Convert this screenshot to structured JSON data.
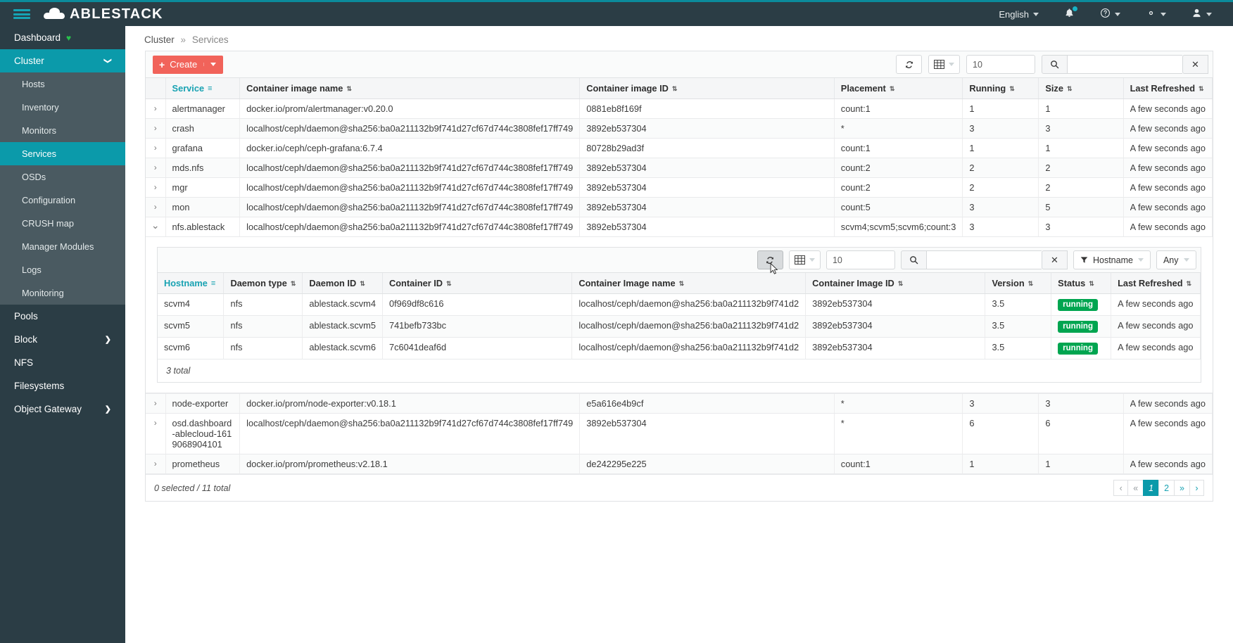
{
  "topbar": {
    "brand": "ABLESTACK",
    "language": "English",
    "icons": {
      "hamburger": "hamburger-icon",
      "bell": "notification-bell-icon",
      "help": "help-circle-icon",
      "settings": "gear-icon",
      "user": "user-icon"
    }
  },
  "sidebar": {
    "items": [
      {
        "label": "Dashboard",
        "level": "top",
        "state": "normal",
        "heart": true
      },
      {
        "label": "Cluster",
        "level": "top",
        "state": "expanded",
        "chevron": "chevron-down"
      },
      {
        "label": "Hosts",
        "level": "sub",
        "state": "normal"
      },
      {
        "label": "Inventory",
        "level": "sub",
        "state": "normal"
      },
      {
        "label": "Monitors",
        "level": "sub",
        "state": "normal"
      },
      {
        "label": "Services",
        "level": "sub",
        "state": "active"
      },
      {
        "label": "OSDs",
        "level": "sub",
        "state": "normal"
      },
      {
        "label": "Configuration",
        "level": "sub",
        "state": "normal"
      },
      {
        "label": "CRUSH map",
        "level": "sub",
        "state": "normal"
      },
      {
        "label": "Manager Modules",
        "level": "sub",
        "state": "normal"
      },
      {
        "label": "Logs",
        "level": "sub",
        "state": "normal"
      },
      {
        "label": "Monitoring",
        "level": "sub",
        "state": "normal"
      },
      {
        "label": "Pools",
        "level": "top",
        "state": "normal"
      },
      {
        "label": "Block",
        "level": "top",
        "state": "normal",
        "chevron": "chevron-right"
      },
      {
        "label": "NFS",
        "level": "top",
        "state": "normal"
      },
      {
        "label": "Filesystems",
        "level": "top",
        "state": "normal"
      },
      {
        "label": "Object Gateway",
        "level": "top",
        "state": "normal",
        "chevron": "chevron-right"
      }
    ]
  },
  "breadcrumb": {
    "parent": "Cluster",
    "separator": "»",
    "current": "Services"
  },
  "toolbar": {
    "create_label": "Create",
    "page_size": "10",
    "search_value": "",
    "search_placeholder": ""
  },
  "table": {
    "columns": [
      {
        "label": "Service",
        "sorted": true
      },
      {
        "label": "Container image name",
        "sorted": false
      },
      {
        "label": "Container image ID",
        "sorted": false
      },
      {
        "label": "Placement",
        "sorted": false
      },
      {
        "label": "Running",
        "sorted": false
      },
      {
        "label": "Size",
        "sorted": false
      },
      {
        "label": "Last Refreshed",
        "sorted": false
      }
    ],
    "rows": [
      {
        "expanded": false,
        "service": "alertmanager",
        "image_name": "docker.io/prom/alertmanager:v0.20.0",
        "image_id": "0881eb8f169f",
        "placement": "count:1",
        "running": "1",
        "size": "1",
        "last_refreshed": "A few seconds ago"
      },
      {
        "expanded": false,
        "service": "crash",
        "image_name": "localhost/ceph/daemon@sha256:ba0a211132b9f741d27cf67d744c3808fef17ff749",
        "image_id": "3892eb537304",
        "placement": "*",
        "running": "3",
        "size": "3",
        "last_refreshed": "A few seconds ago"
      },
      {
        "expanded": false,
        "service": "grafana",
        "image_name": "docker.io/ceph/ceph-grafana:6.7.4",
        "image_id": "80728b29ad3f",
        "placement": "count:1",
        "running": "1",
        "size": "1",
        "last_refreshed": "A few seconds ago"
      },
      {
        "expanded": false,
        "service": "mds.nfs",
        "image_name": "localhost/ceph/daemon@sha256:ba0a211132b9f741d27cf67d744c3808fef17ff749",
        "image_id": "3892eb537304",
        "placement": "count:2",
        "running": "2",
        "size": "2",
        "last_refreshed": "A few seconds ago"
      },
      {
        "expanded": false,
        "service": "mgr",
        "image_name": "localhost/ceph/daemon@sha256:ba0a211132b9f741d27cf67d744c3808fef17ff749",
        "image_id": "3892eb537304",
        "placement": "count:2",
        "running": "2",
        "size": "2",
        "last_refreshed": "A few seconds ago"
      },
      {
        "expanded": false,
        "service": "mon",
        "image_name": "localhost/ceph/daemon@sha256:ba0a211132b9f741d27cf67d744c3808fef17ff749",
        "image_id": "3892eb537304",
        "placement": "count:5",
        "running": "3",
        "size": "5",
        "last_refreshed": "A few seconds ago"
      },
      {
        "expanded": true,
        "service": "nfs.ablestack",
        "image_name": "localhost/ceph/daemon@sha256:ba0a211132b9f741d27cf67d744c3808fef17ff749",
        "image_id": "3892eb537304",
        "placement": "scvm4;scvm5;scvm6;count:3",
        "running": "3",
        "size": "3",
        "last_refreshed": "A few seconds ago"
      },
      {
        "expanded": false,
        "service": "node-exporter",
        "image_name": "docker.io/prom/node-exporter:v0.18.1",
        "image_id": "e5a616e4b9cf",
        "placement": "*",
        "running": "3",
        "size": "3",
        "last_refreshed": "A few seconds ago"
      },
      {
        "expanded": false,
        "service": "osd.dashboard-ablecloud-1619068904101",
        "image_name": "localhost/ceph/daemon@sha256:ba0a211132b9f741d27cf67d744c3808fef17ff749",
        "image_id": "3892eb537304",
        "placement": "*",
        "running": "6",
        "size": "6",
        "last_refreshed": "A few seconds ago"
      },
      {
        "expanded": false,
        "service": "prometheus",
        "image_name": "docker.io/prom/prometheus:v2.18.1",
        "image_id": "de242295e225",
        "placement": "count:1",
        "running": "1",
        "size": "1",
        "last_refreshed": "A few seconds ago"
      }
    ],
    "footer_text": "0 selected / 11 total",
    "pagination": {
      "first": "‹",
      "prev": "«",
      "pages": [
        "1",
        "2"
      ],
      "active_page": "1",
      "next": "»",
      "last": "›"
    }
  },
  "nested": {
    "toolbar": {
      "page_size": "10",
      "search_value": "",
      "filter_label": "Hostname",
      "filter_any": "Any"
    },
    "columns": [
      {
        "label": "Hostname",
        "sorted": true
      },
      {
        "label": "Daemon type",
        "sorted": false
      },
      {
        "label": "Daemon ID",
        "sorted": false
      },
      {
        "label": "Container ID",
        "sorted": false
      },
      {
        "label": "Container Image name",
        "sorted": false
      },
      {
        "label": "Container Image ID",
        "sorted": false
      },
      {
        "label": "Version",
        "sorted": false
      },
      {
        "label": "Status",
        "sorted": false
      },
      {
        "label": "Last Refreshed",
        "sorted": false
      }
    ],
    "rows": [
      {
        "hostname": "scvm4",
        "daemon_type": "nfs",
        "daemon_id": "ablestack.scvm4",
        "container_id": "0f969df8c616",
        "image_name": "localhost/ceph/daemon@sha256:ba0a211132b9f741d2",
        "image_id": "3892eb537304",
        "version": "3.5",
        "status": "running",
        "last_refreshed": "A few seconds ago"
      },
      {
        "hostname": "scvm5",
        "daemon_type": "nfs",
        "daemon_id": "ablestack.scvm5",
        "container_id": "741befb733bc",
        "image_name": "localhost/ceph/daemon@sha256:ba0a211132b9f741d2",
        "image_id": "3892eb537304",
        "version": "3.5",
        "status": "running",
        "last_refreshed": "A few seconds ago"
      },
      {
        "hostname": "scvm6",
        "daemon_type": "nfs",
        "daemon_id": "ablestack.scvm6",
        "container_id": "7c6041deaf6d",
        "image_name": "localhost/ceph/daemon@sha256:ba0a211132b9f741d2",
        "image_id": "3892eb537304",
        "version": "3.5",
        "status": "running",
        "last_refreshed": "A few seconds ago"
      }
    ],
    "footer_text": "3 total"
  },
  "colors": {
    "accent": "#0b9aaa",
    "sidebar": "#2b3d45",
    "create": "#f1635a",
    "running": "#00a550"
  }
}
